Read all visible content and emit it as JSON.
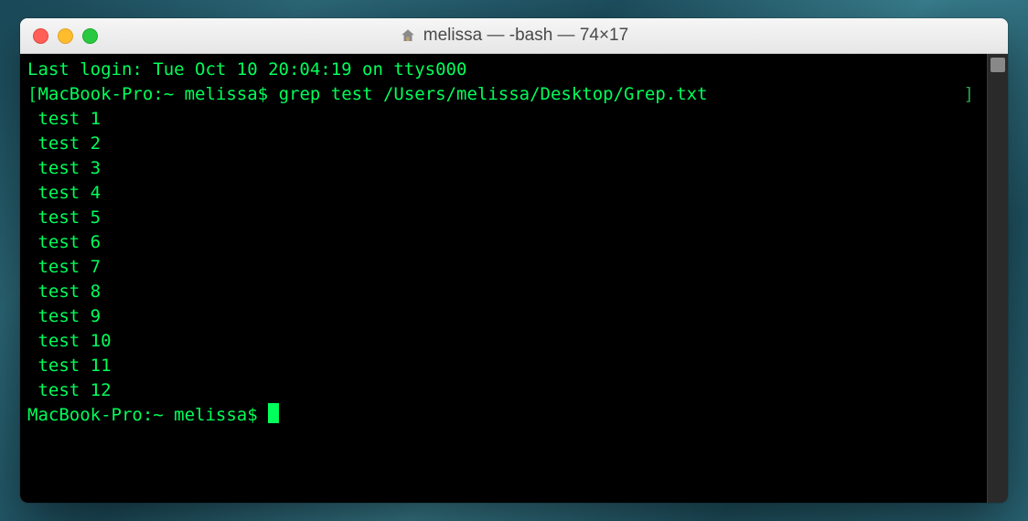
{
  "window": {
    "title": "melissa — -bash — 74×17"
  },
  "terminal": {
    "last_login": "Last login: Tue Oct 10 20:04:19 on ttys000",
    "prompt_prefix_open": "[",
    "prompt": "MacBook-Pro:~ melissa$ ",
    "command": "grep test /Users/melissa/Desktop/Grep.txt",
    "right_bracket": "]",
    "output_lines": [
      " test 1",
      " test 2",
      " test 3",
      " test 4",
      " test 5",
      " test 6",
      " test 7",
      " test 8",
      " test 9",
      " test 10",
      " test 11",
      " test 12"
    ],
    "prompt2": "MacBook-Pro:~ melissa$ "
  }
}
